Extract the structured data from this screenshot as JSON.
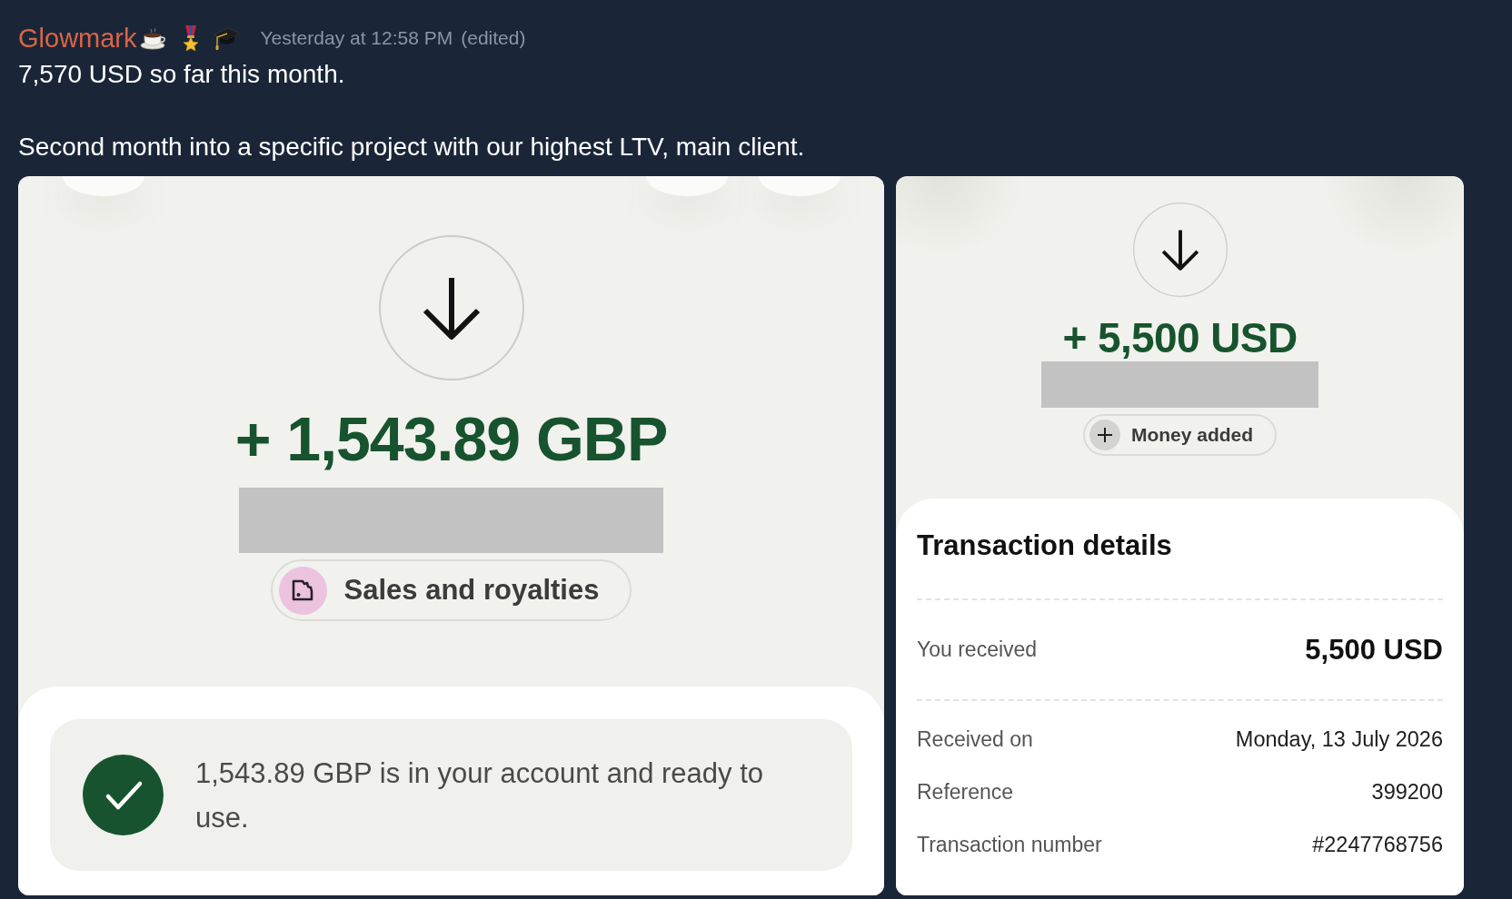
{
  "message": {
    "author": "Glowmark",
    "timestamp": "Yesterday at 12:58 PM",
    "edited_note": "(edited)",
    "paragraphs": [
      "7,570 USD so far this month.",
      "Second month into a specific project with our highest LTV, main client."
    ]
  },
  "attachments": [
    {
      "kind": "deposit_notice",
      "amount": "+ 1,543.89 GBP",
      "category": "Sales and royalties",
      "notice": "1,543.89 GBP is in your account and ready to use."
    },
    {
      "kind": "transaction_details",
      "amount": "+ 5,500 USD",
      "category": "Money added",
      "details_title": "Transaction details",
      "summary": {
        "label": "You received",
        "value": "5,500 USD"
      },
      "rows": [
        {
          "label": "Received on",
          "value": "Monday, 13 July 2026"
        },
        {
          "label": "Reference",
          "value": "399200"
        },
        {
          "label": "Transaction number",
          "value": "#2247768756"
        }
      ]
    }
  ]
}
